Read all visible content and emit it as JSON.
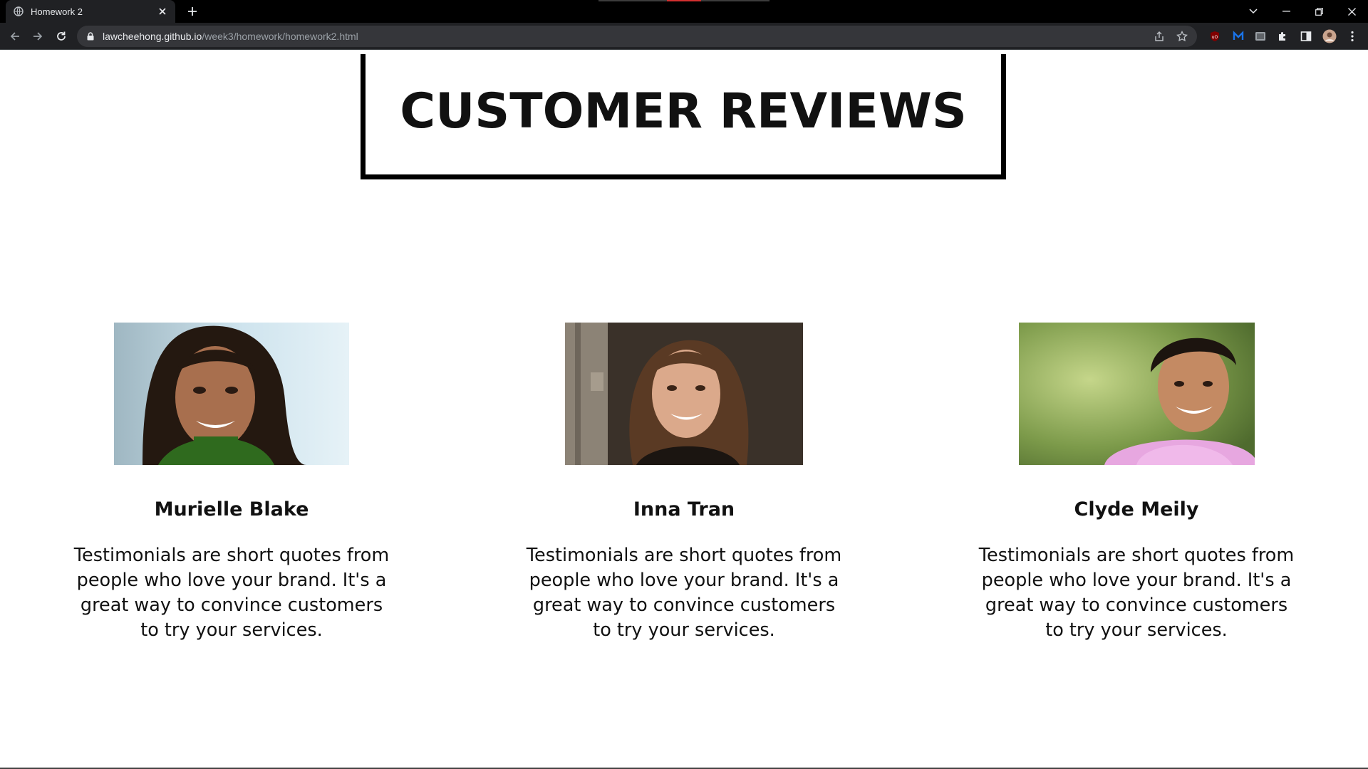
{
  "browser": {
    "tab": {
      "title": "Homework 2"
    },
    "address": {
      "host": "lawcheehong.github.io",
      "path": "/week3/homework/homework2.html"
    },
    "colors": {
      "chrome_bg": "#202124",
      "tabbar_bg": "#000000",
      "omnibox_bg": "#35363a"
    }
  },
  "page": {
    "heading": "CUSTOMER REVIEWS",
    "reviews": [
      {
        "name": "Murielle Blake",
        "text": "Testimonials are short quotes from people who love your brand. It's a great way to convince customers to try your services."
      },
      {
        "name": "Inna Tran",
        "text": "Testimonials are short quotes from people who love your brand. It's a great way to convince customers to try your services."
      },
      {
        "name": "Clyde Meily",
        "text": "Testimonials are short quotes from people who love your brand. It's a great way to convince customers to try your services."
      }
    ]
  }
}
